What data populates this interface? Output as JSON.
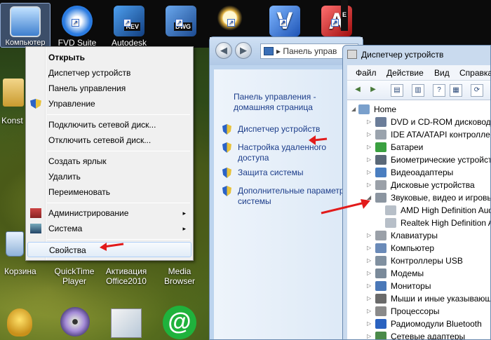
{
  "desktop": {
    "top_icons": [
      {
        "label": "Компьютер",
        "icon": "computer-icon",
        "color": "#6aa4e0"
      },
      {
        "label": "FVD Suite",
        "icon": "fvd-icon",
        "color": "#2a7be0"
      },
      {
        "label": "Autodesk",
        "icon": "autodesk-revit-icon",
        "color": "#1f6fc4",
        "tag": "REV"
      },
      {
        "label": "DWG",
        "icon": "dwg-icon",
        "color": "#2a5fb0",
        "tag": "DWG"
      },
      {
        "label": "",
        "icon": "magnifier-icon",
        "color": "#e0b040"
      },
      {
        "label": "",
        "icon": "v-app-icon",
        "color": "#3070d0"
      },
      {
        "label": "",
        "icon": "autocad-icon",
        "color": "#d02020",
        "tag": "E"
      }
    ],
    "side_labels": {
      "konst": "Konst",
      "korzina": "Корзина"
    },
    "bottom_icons": [
      {
        "label": "QuickTime Player"
      },
      {
        "label": "Активация Office2010"
      },
      {
        "label": "Media Browser"
      }
    ]
  },
  "context_menu": {
    "items": [
      {
        "label": "Открыть",
        "bold": true
      },
      {
        "label": "Диспетчер устройств"
      },
      {
        "label": "Панель управления"
      },
      {
        "label": "Управление",
        "shield": true
      },
      {
        "label": "Подключить сетевой диск..."
      },
      {
        "label": "Отключить сетевой диск..."
      },
      {
        "label": "Создать ярлык"
      },
      {
        "label": "Удалить"
      },
      {
        "label": "Переименовать"
      },
      {
        "label": "Администрирование",
        "submenu": "▸"
      },
      {
        "label": "Система",
        "submenu": "▸"
      },
      {
        "label": "Свойства",
        "highlight": true
      }
    ]
  },
  "control_panel": {
    "address": "Панель управ",
    "home_link": "Панель управления - домашняя страница",
    "links": [
      "Диспетчер устройств",
      "Настройка удаленного доступа",
      "Защита системы",
      "Дополнительные параметры системы"
    ]
  },
  "device_manager": {
    "title": "Диспетчер устройств",
    "menu": [
      "Файл",
      "Действие",
      "Вид",
      "Справка"
    ],
    "root": "Home",
    "nodes": [
      {
        "label": "DVD и CD-ROM дисководы",
        "icon": "dvd-drive-icon"
      },
      {
        "label": "IDE ATA/ATAPI контроллеры",
        "icon": "ide-controller-icon"
      },
      {
        "label": "Батареи",
        "icon": "battery-icon"
      },
      {
        "label": "Биометрические устройства",
        "icon": "biometric-icon"
      },
      {
        "label": "Видеоадаптеры",
        "icon": "display-adapter-icon"
      },
      {
        "label": "Дисковые устройства",
        "icon": "disk-drive-icon"
      },
      {
        "label": "Звуковые, видео и игровые устройства",
        "icon": "sound-icon",
        "expanded": true
      },
      {
        "label": "AMD High Definition Audio Device",
        "icon": "speaker-icon",
        "child": true
      },
      {
        "label": "Realtek High Definition Audio",
        "icon": "speaker-icon",
        "child": true
      },
      {
        "label": "Клавиатуры",
        "icon": "keyboard-icon"
      },
      {
        "label": "Компьютер",
        "icon": "computer-icon"
      },
      {
        "label": "Контроллеры USB",
        "icon": "usb-icon"
      },
      {
        "label": "Модемы",
        "icon": "modem-icon"
      },
      {
        "label": "Мониторы",
        "icon": "monitor-icon"
      },
      {
        "label": "Мыши и иные указывающие устройства",
        "icon": "mouse-icon"
      },
      {
        "label": "Процессоры",
        "icon": "cpu-icon"
      },
      {
        "label": "Радиомодули Bluetooth",
        "icon": "bluetooth-icon"
      },
      {
        "label": "Сетевые адаптеры",
        "icon": "network-adapter-icon"
      }
    ]
  },
  "accent": {
    "arrow": "#e21b1b",
    "link": "#1c3d8a"
  }
}
